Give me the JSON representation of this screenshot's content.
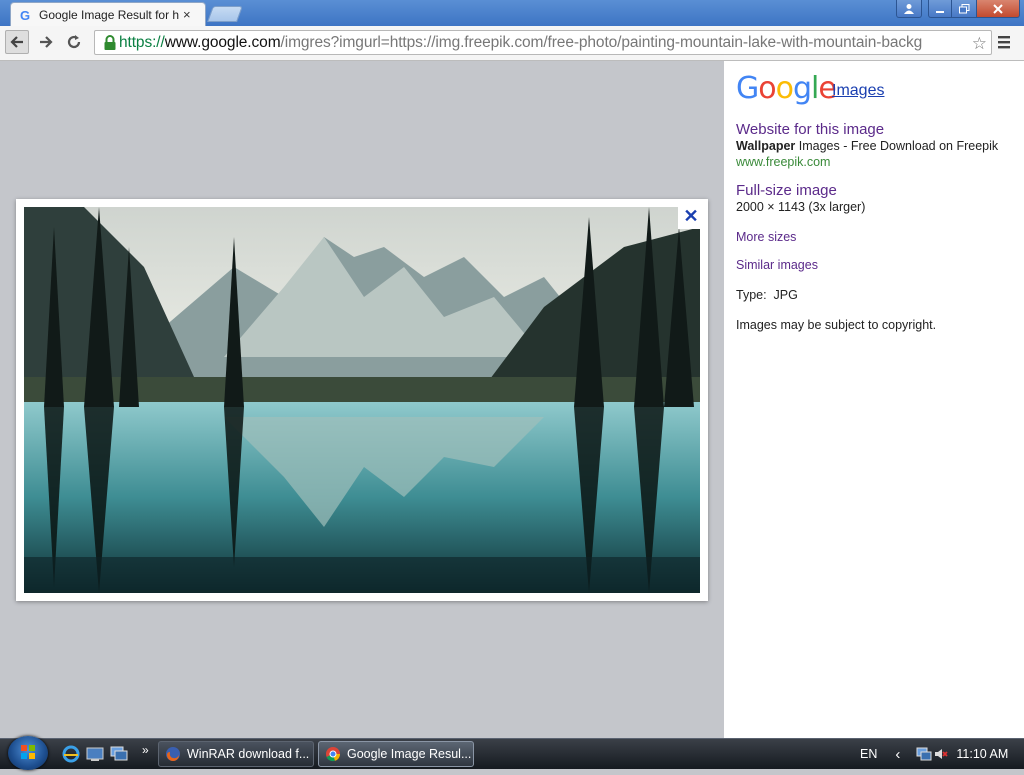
{
  "window": {
    "tab_title": "Google Image Result for h",
    "tab_close": "×",
    "controls": {
      "minimize": "minimize-icon",
      "maximize": "restore-icon",
      "close": "close-icon"
    }
  },
  "toolbar": {
    "url_scheme": "https://",
    "url_host": "www.google.com",
    "url_rest": "/imgres?imgurl=https://img.freepik.com/free-photo/painting-mountain-lake-with-mountain-backg",
    "star": "☆"
  },
  "viewer": {
    "close_label": "✕"
  },
  "sidebar": {
    "logo": {
      "G": "G",
      "o1": "o",
      "o2": "o",
      "g": "g",
      "l": "l",
      "e": "e"
    },
    "images_link": "Images",
    "website_link": "Website for this image",
    "site_title_bold": "Wallpaper",
    "site_title_rest": " Images - Free Download on Freepik",
    "site_url": "www.freepik.com",
    "fullsize_link": "Full-size image",
    "dimensions": "2000 × 1143 (3x larger)",
    "more_sizes": "More sizes",
    "similar_images": "Similar images",
    "type_label": "Type:",
    "type_value": "JPG",
    "copyright": "Images may be subject to copyright."
  },
  "colors": {
    "google_blue": "#4285f4",
    "google_red": "#ea4335",
    "google_yellow": "#fbbc05",
    "google_green": "#34a853",
    "link_visited": "#5b2a8a"
  },
  "taskbar": {
    "items": [
      {
        "label": "WinRAR download f...",
        "icon": "firefox-icon"
      },
      {
        "label": "Google Image Resul...",
        "icon": "chrome-icon"
      }
    ],
    "quicklaunch_more": "»",
    "language": "EN",
    "tray_arrow": "‹",
    "clock": "11:10 AM"
  }
}
